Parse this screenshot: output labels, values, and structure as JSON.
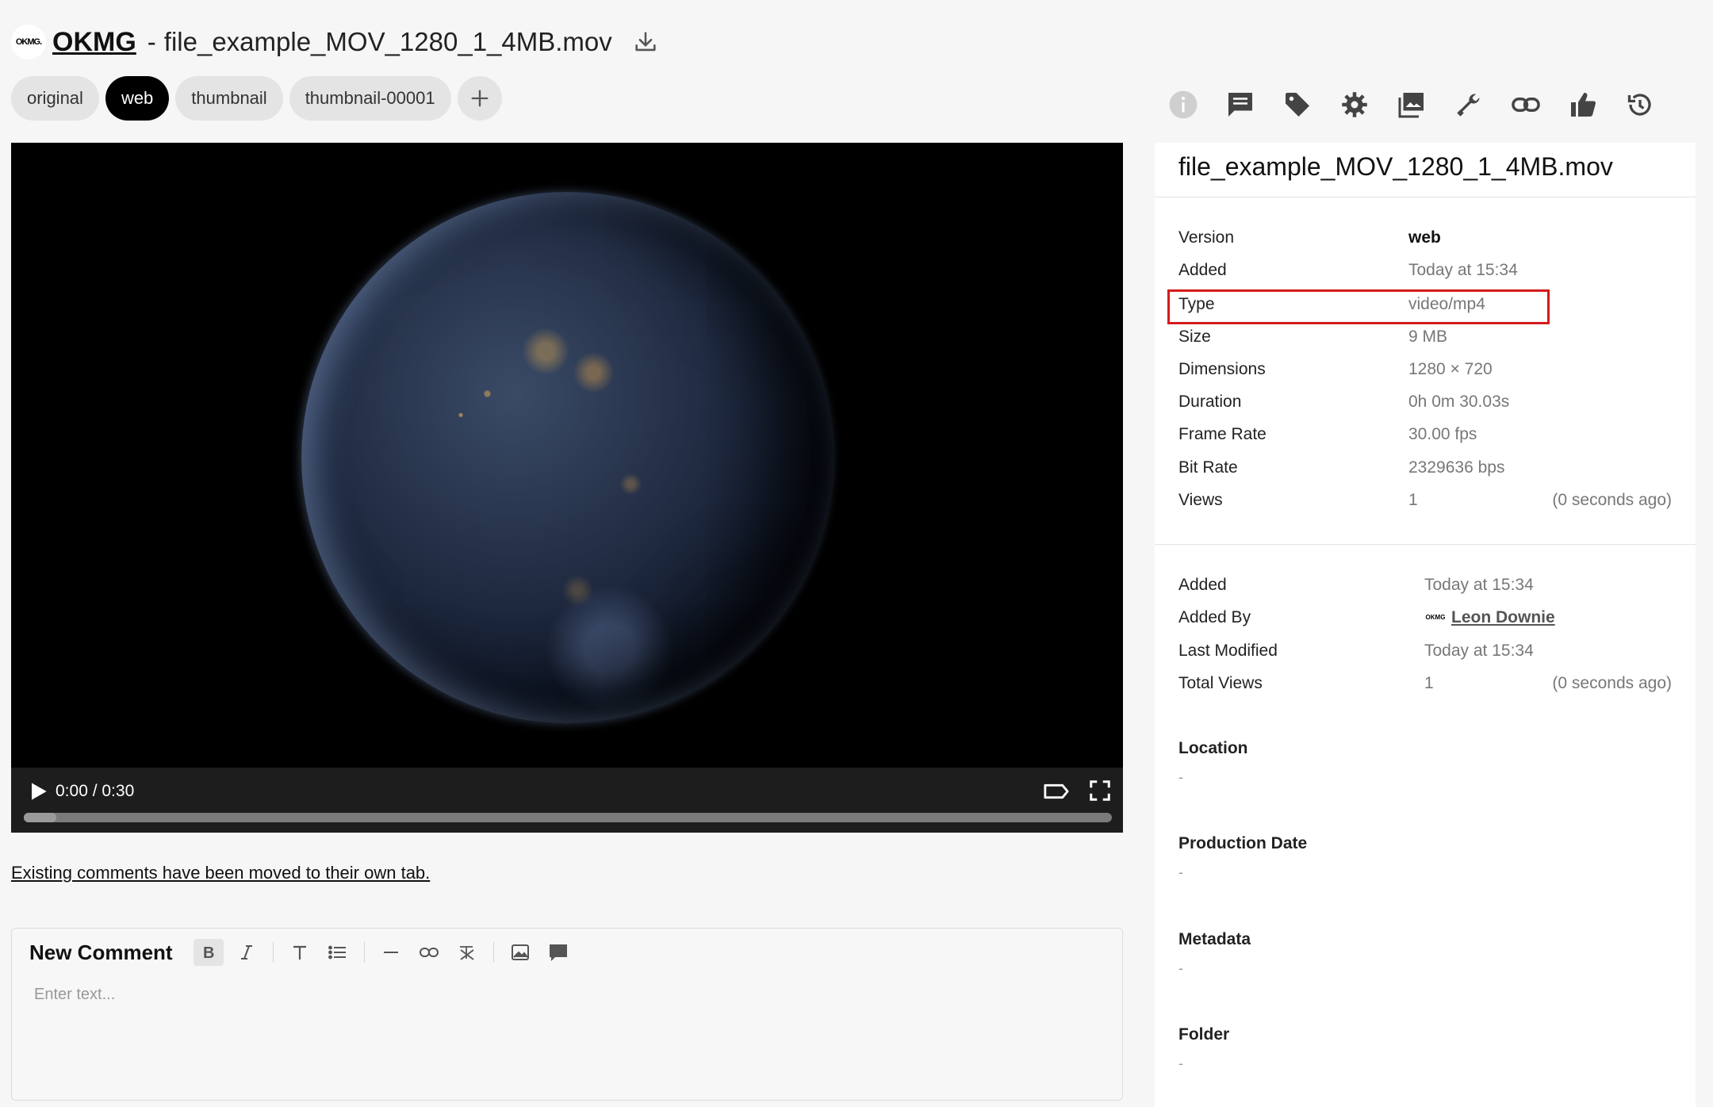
{
  "header": {
    "org_logo_text": "OKMG.",
    "org_name": "OKMG",
    "separator": "-",
    "file_title": "file_example_MOV_1280_1_4MB.mov"
  },
  "version_tabs": [
    {
      "label": "original",
      "active": false
    },
    {
      "label": "web",
      "active": true
    },
    {
      "label": "thumbnail",
      "active": false
    },
    {
      "label": "thumbnail-00001",
      "active": false
    }
  ],
  "player": {
    "time": "0:00 / 0:30",
    "progress": 0.03
  },
  "comments_note": "Existing comments have been moved to their own tab.",
  "comment_editor": {
    "label": "New Comment",
    "placeholder": "Enter text..."
  },
  "panel_toolbar_icons": [
    "info-icon",
    "comment-icon",
    "tag-icon",
    "gear-icon",
    "image-icon",
    "wrench-icon",
    "link-icon",
    "thumbs-up-icon",
    "history-icon"
  ],
  "panel": {
    "title": "file_example_MOV_1280_1_4MB.mov",
    "version_info": {
      "version_label": "Version",
      "version_value": "web",
      "added_label": "Added",
      "added_value": "Today at 15:34",
      "type_label": "Type",
      "type_value": "video/mp4",
      "size_label": "Size",
      "size_value": "9 MB",
      "dimensions_label": "Dimensions",
      "dimensions_value": "1280 × 720",
      "duration_label": "Duration",
      "duration_value": "0h 0m 30.03s",
      "frame_rate_label": "Frame Rate",
      "frame_rate_value": "30.00 fps",
      "bit_rate_label": "Bit Rate",
      "bit_rate_value": "2329636 bps",
      "views_label": "Views",
      "views_value": "1",
      "views_ago": "(0 seconds ago)"
    },
    "asset_info": {
      "added_label": "Added",
      "added_value": "Today at 15:34",
      "added_by_label": "Added By",
      "added_by_value": "Leon Downie",
      "added_by_avatar": "OKMG",
      "last_modified_label": "Last Modified",
      "last_modified_value": "Today at 15:34",
      "total_views_label": "Total Views",
      "total_views_value": "1",
      "total_views_ago": "(0 seconds ago)"
    },
    "sections": {
      "location_label": "Location",
      "location_value": "-",
      "production_date_label": "Production Date",
      "production_date_value": "-",
      "metadata_label": "Metadata",
      "metadata_value": "-",
      "folder_label": "Folder",
      "folder_value": "-"
    }
  },
  "colors": {
    "highlight": "#d31b1b",
    "active_tab_bg": "#000000",
    "tab_bg": "#e4e4e4"
  }
}
